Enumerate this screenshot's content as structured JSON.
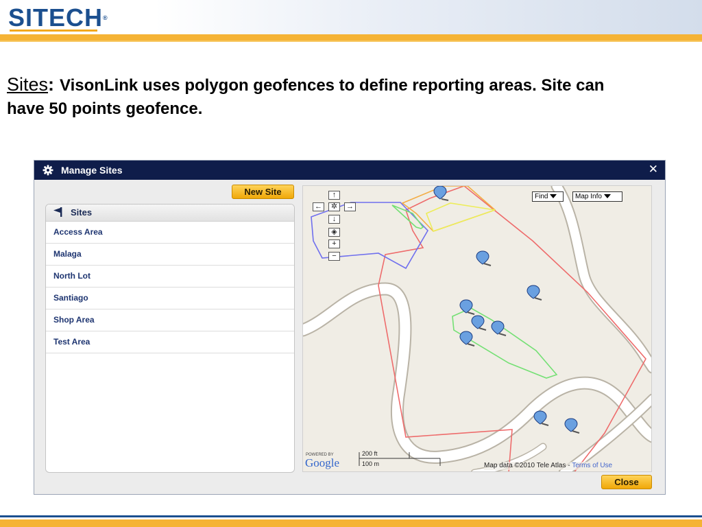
{
  "header": {
    "logo_text": "SITECH",
    "logo_tm": "®"
  },
  "slide": {
    "heading": "Sites",
    "colon": ":",
    "body": "VisonLink uses polygon geofences to define reporting areas. Site can have 50 points geofence."
  },
  "dialog": {
    "title": "Manage Sites",
    "title_icon": "gear-icon",
    "close_glyph": "✕",
    "new_site_label": "New Site",
    "close_label": "Close"
  },
  "sites_panel": {
    "header": "Sites",
    "items": [
      {
        "label": "Access Area"
      },
      {
        "label": "Malaga"
      },
      {
        "label": "North Lot"
      },
      {
        "label": "Santiago"
      },
      {
        "label": "Shop Area"
      },
      {
        "label": "Test Area"
      }
    ]
  },
  "map": {
    "find_label": "Find",
    "mapinfo_label": "Map Info",
    "nav": {
      "up": "↑",
      "left": "←",
      "center": "✲",
      "right": "→",
      "down": "↓",
      "reset": "◈",
      "zoom_in": "+",
      "zoom_out": "−"
    },
    "powered_by": "POWERED BY",
    "google": "Google",
    "scale_ft": "200 ft",
    "scale_m": "100 m",
    "attribution": "Map data ©2010  Tele Atlas - ",
    "terms": "Terms of Use"
  },
  "colors": {
    "brand_blue": "#1b4f8f",
    "brand_orange": "#f5b335",
    "titlebar": "#0f1d4a",
    "button": "#f0a808"
  }
}
